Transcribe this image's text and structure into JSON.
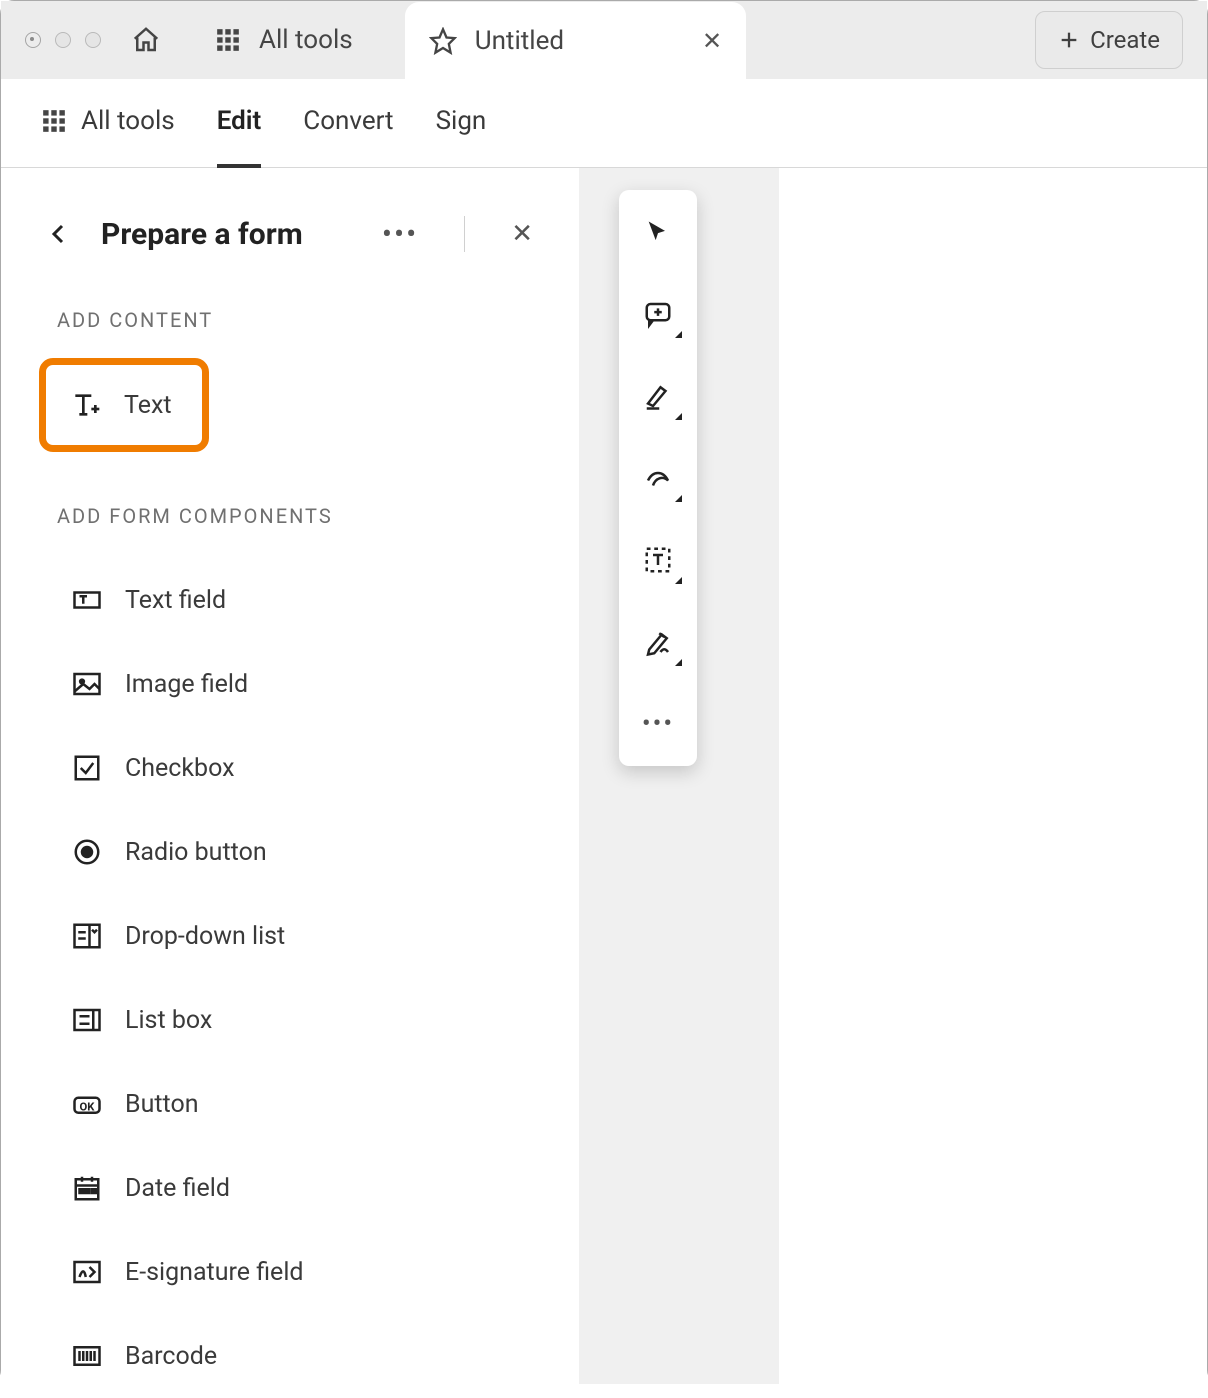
{
  "titlebar": {
    "left_tab_label": "All tools",
    "doc_tab_label": "Untitled",
    "create_label": "Create"
  },
  "toolbar": {
    "all_tools": "All tools",
    "edit": "Edit",
    "convert": "Convert",
    "sign": "Sign",
    "active": "Edit"
  },
  "panel": {
    "title": "Prepare a form",
    "section_add_content": "ADD CONTENT",
    "section_add_form": "ADD FORM COMPONENTS",
    "text_label": "Text",
    "components": [
      "Text field",
      "Image field",
      "Checkbox",
      "Radio button",
      "Drop-down list",
      "List box",
      "Button",
      "Date field",
      "E-signature field",
      "Barcode"
    ]
  }
}
